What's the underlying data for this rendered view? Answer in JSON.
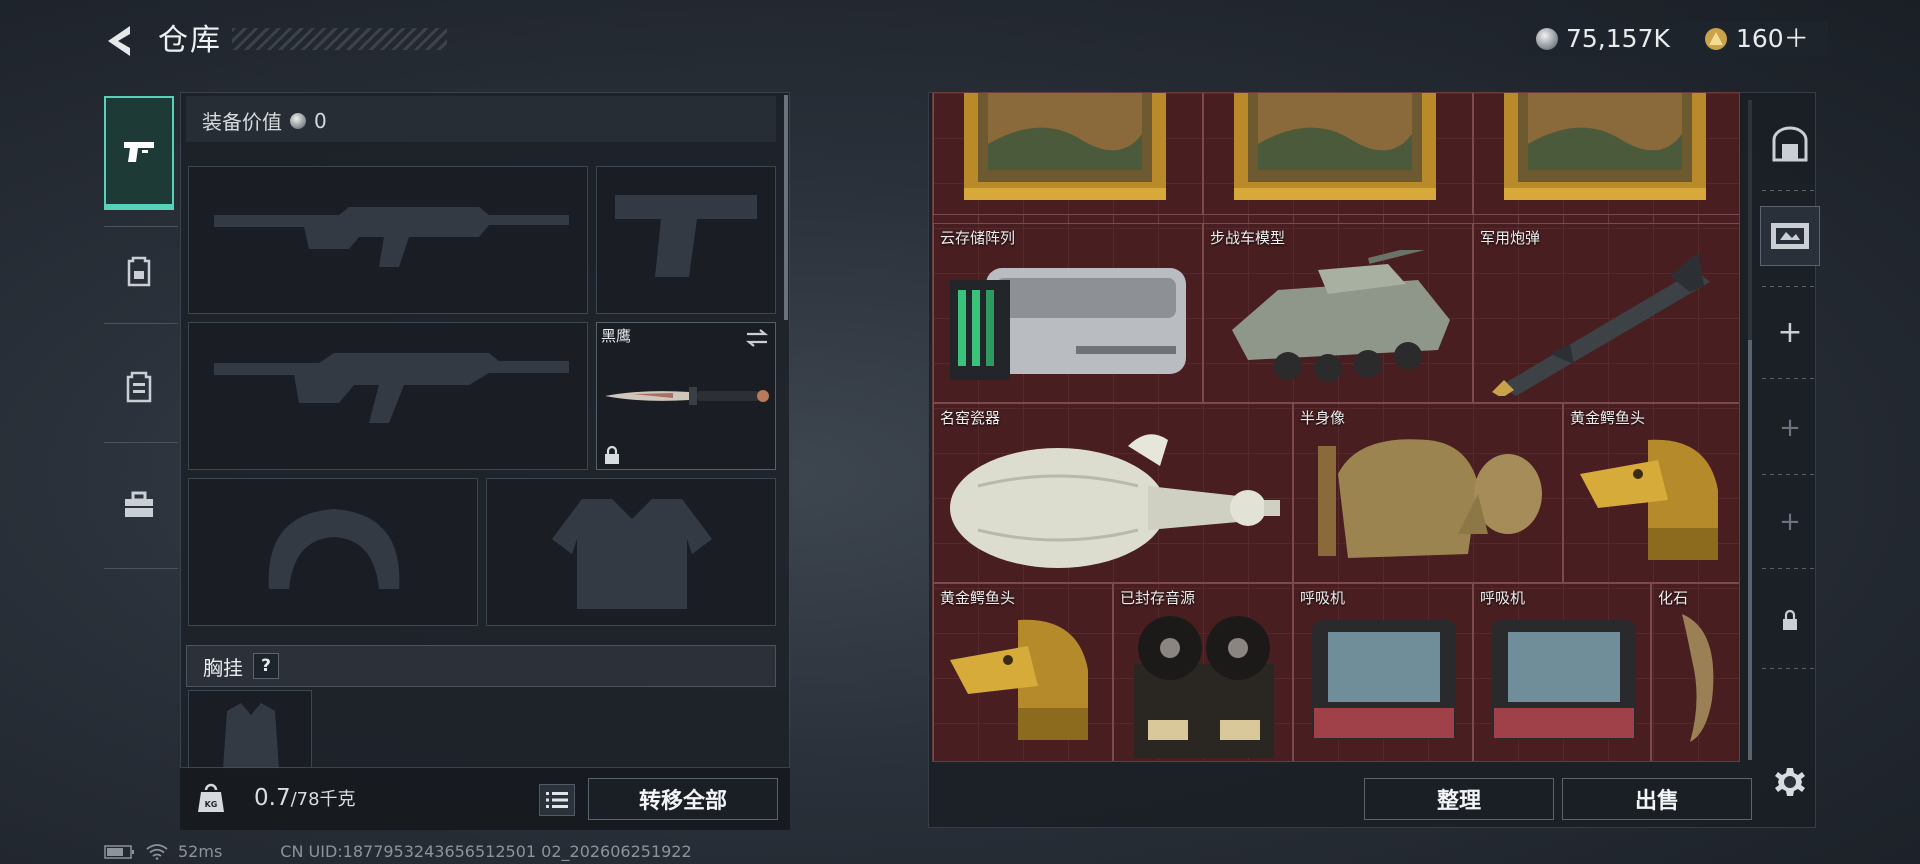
{
  "header": {
    "title": "仓库",
    "currency": [
      {
        "icon": "silver-coin-icon",
        "amount": "75,157K"
      },
      {
        "icon": "gold-triangle-coin-icon",
        "amount": "160＋"
      }
    ]
  },
  "left_tabs": [
    "pistol-icon",
    "backpack-icon",
    "vest-icon",
    "toolbox-icon"
  ],
  "equipment": {
    "value_label": "装备价值",
    "value": "0",
    "melee_slot": {
      "name": "黑鹰"
    },
    "chest_rig_label": "胸挂",
    "chest_rig_help": "?",
    "weight_current": "0.7",
    "weight_max": "/78千克",
    "transfer_all_label": "转移全部"
  },
  "storage": {
    "items": [
      {
        "label": "",
        "kind": "painting"
      },
      {
        "label": "",
        "kind": "painting"
      },
      {
        "label": "",
        "kind": "painting"
      },
      {
        "label": "云存储阵列",
        "kind": "server"
      },
      {
        "label": "步战车模型",
        "kind": "ifv"
      },
      {
        "label": "军用炮弹",
        "kind": "missile"
      },
      {
        "label": "名窑瓷器",
        "kind": "vase"
      },
      {
        "label": "半身像",
        "kind": "bust"
      },
      {
        "label": "黄金鳄鱼头",
        "kind": "croc"
      },
      {
        "label": "黄金鳄鱼头",
        "kind": "croc"
      },
      {
        "label": "已封存音源",
        "kind": "reel"
      },
      {
        "label": "呼吸机",
        "kind": "ventilator"
      },
      {
        "label": "呼吸机",
        "kind": "ventilator"
      },
      {
        "label": "化石",
        "kind": "fossil"
      }
    ],
    "sort_label": "整理",
    "sell_label": "出售"
  },
  "right_tabs": [
    "vault-icon",
    "ticket-icon",
    "plus-icon",
    "plus-icon",
    "plus-icon",
    "lock-icon"
  ],
  "status": {
    "ping": "52ms",
    "uid": "CN UID:1877953243656512501 02_202606251922"
  },
  "colors": {
    "accent": "#57d1b8",
    "storage_bg": "#4a1e22"
  }
}
